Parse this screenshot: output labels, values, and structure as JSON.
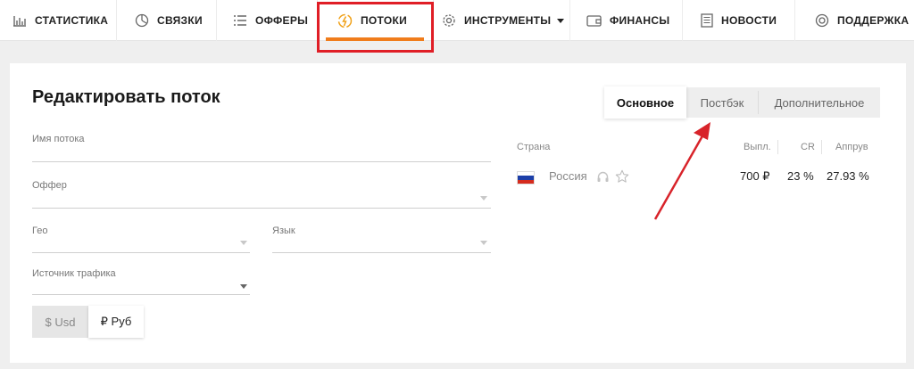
{
  "nav": {
    "items": [
      {
        "label": "СТАТИСТИКА",
        "icon": "bar-chart-icon"
      },
      {
        "label": "СВЯЗКИ",
        "icon": "pie-chart-icon"
      },
      {
        "label": "ОФФЕРЫ",
        "icon": "list-icon"
      },
      {
        "label": "ПОТОКИ",
        "icon": "flow-coin-icon",
        "active": true
      },
      {
        "label": "ИНСТРУМЕНТЫ",
        "icon": "gear-icon",
        "dropdown": true
      },
      {
        "label": "ФИНАНСЫ",
        "icon": "wallet-icon"
      },
      {
        "label": "НОВОСТИ",
        "icon": "news-icon"
      },
      {
        "label": "ПОДДЕРЖКА",
        "icon": "lifebuoy-icon"
      }
    ],
    "active_color": "#f07c1b",
    "highlight_color": "#e01e26"
  },
  "form": {
    "title": "Редактировать поток",
    "fields": {
      "name_label": "Имя потока",
      "offer_label": "Оффер",
      "geo_label": "Гео",
      "language_label": "Язык",
      "traffic_label": "Источник трафика"
    },
    "currency": {
      "usd": "$ Usd",
      "rub": "₽ Руб",
      "selected": "rub"
    }
  },
  "tabs": [
    {
      "label": "Основное",
      "active": true
    },
    {
      "label": "Постбэк",
      "active": false
    },
    {
      "label": "Дополнительное",
      "active": false
    }
  ],
  "geo_table": {
    "headers": {
      "country": "Страна",
      "payout": "Выпл.",
      "cr": "CR",
      "approval": "Аппрув"
    },
    "rows": [
      {
        "flag": "russia-flag",
        "country": "Россия",
        "payout": "700 ₽",
        "cr": "23 %",
        "approval": "27.93 %"
      }
    ]
  },
  "annotation_color": "#d8232a"
}
